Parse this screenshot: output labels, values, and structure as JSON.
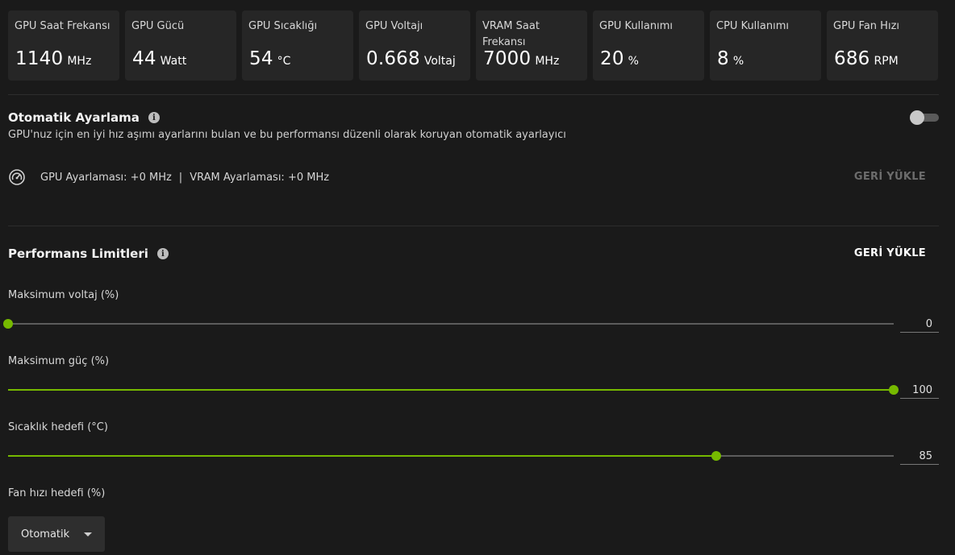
{
  "stats": [
    {
      "label": "GPU Saat Frekansı",
      "value": "1140",
      "unit": "MHz"
    },
    {
      "label": "GPU Gücü",
      "value": "44",
      "unit": "Watt"
    },
    {
      "label": "GPU Sıcaklığı",
      "value": "54",
      "unit": "°C"
    },
    {
      "label": "GPU Voltajı",
      "value": "0.668",
      "unit": "Voltaj"
    },
    {
      "label": "VRAM Saat Frekansı",
      "value": "7000",
      "unit": "MHz"
    },
    {
      "label": "GPU Kullanımı",
      "value": "20",
      "unit": "%"
    },
    {
      "label": "CPU Kullanımı",
      "value": "8",
      "unit": "%"
    },
    {
      "label": "GPU Fan Hızı",
      "value": "686",
      "unit": "RPM"
    }
  ],
  "auto_tuning": {
    "title": "Otomatik Ayarlama",
    "description": "GPU'nuz için en iyi hız aşımı ayarlarını bulan ve bu performansı düzenli olarak koruyan otomatik ayarlayıcı",
    "enabled": false,
    "gpu_tuning": "GPU Ayarlaması: +0 MHz",
    "separator": "|",
    "vram_tuning": "VRAM Ayarlaması: +0 MHz",
    "reset_label": "GERİ YÜKLE"
  },
  "performance_limits": {
    "title": "Performans Limitleri",
    "reset_label": "GERİ YÜKLE",
    "sliders": [
      {
        "label": "Maksimum voltaj (%)",
        "value": "0",
        "fraction": 0.0
      },
      {
        "label": "Maksimum güç (%)",
        "value": "100",
        "fraction": 1.0
      },
      {
        "label": "Sıcaklık hedefi (°C)",
        "value": "85",
        "fraction": 0.8
      }
    ],
    "fan": {
      "label": "Fan hızı hedefi (%)",
      "selected": "Otomatik"
    }
  },
  "colors": {
    "accent": "#76b900",
    "background": "#1a1a1a",
    "card": "#262626"
  },
  "icons": {
    "info": "info-icon",
    "gauge": "speedometer-icon",
    "dropdown": "chevron-down-icon"
  }
}
